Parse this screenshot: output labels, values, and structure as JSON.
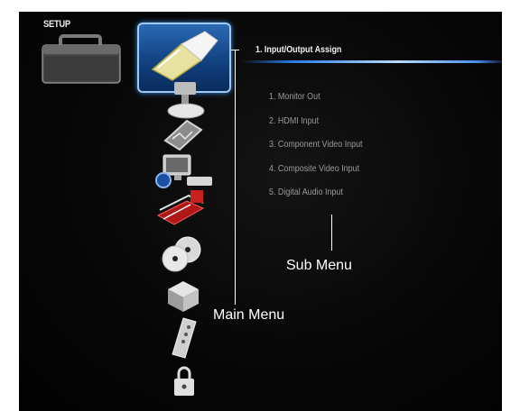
{
  "screen": {
    "setup_label": "SETUP"
  },
  "main_menu": {
    "icons": [
      "hdmi-cable-icon",
      "projector-icon",
      "picture-icon",
      "monitor-remote-icon",
      "red-settings-icon",
      "discs-icon",
      "cube-icon",
      "remote-control-icon",
      "lock-icon"
    ],
    "selected_index": 0
  },
  "selected": {
    "title": "1. Input/Output Assign"
  },
  "submenu": {
    "items": [
      "1. Monitor Out",
      "2. HDMI Input",
      "3. Component Video Input",
      "4. Composite Video Input",
      "5. Digital Audio Input"
    ]
  },
  "annotations": {
    "sub_menu_label": "Sub Menu",
    "main_menu_label": "Main Menu"
  },
  "colors": {
    "accent_blue": "#2b7be8",
    "frame_border": "#9ccaf2",
    "submenu_text": "#9a9a9a"
  }
}
